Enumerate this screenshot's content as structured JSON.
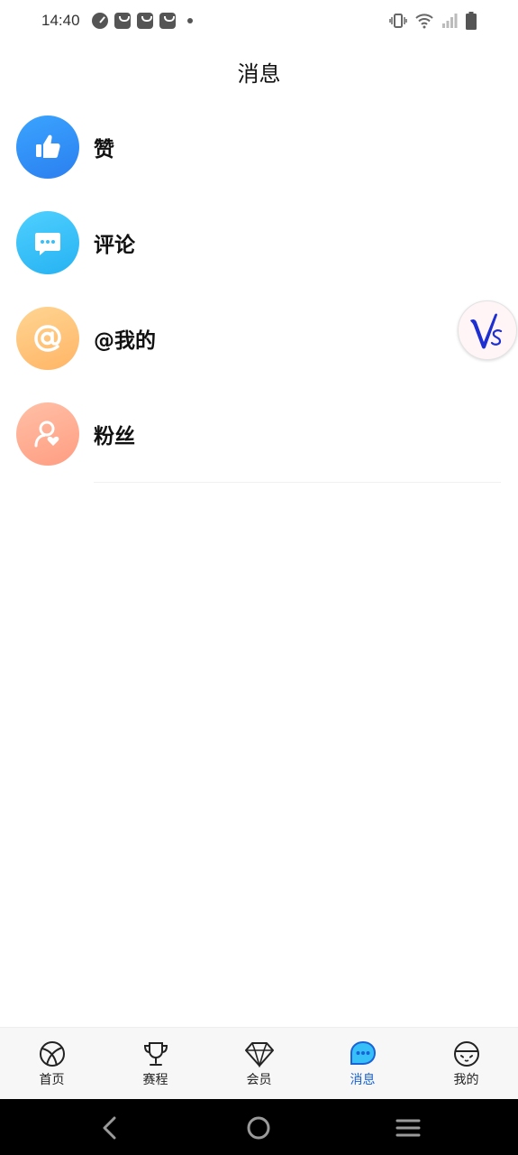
{
  "status_bar": {
    "time": "14:40",
    "icons": [
      "speedometer-icon",
      "bag-icon",
      "bag-icon",
      "bag-icon",
      "dot-icon",
      "vibrate-icon",
      "wifi-icon",
      "signal-icon",
      "battery-icon"
    ]
  },
  "header": {
    "title": "消息"
  },
  "messages": [
    {
      "label": "赞",
      "icon": "thumbs-up-icon",
      "color": "#2f8df5"
    },
    {
      "label": "评论",
      "icon": "chat-bubble-icon",
      "color": "#36c0f7"
    },
    {
      "label": "@我的",
      "icon": "at-sign-icon",
      "color": "#ffc477"
    },
    {
      "label": "粉丝",
      "icon": "fan-user-icon",
      "color": "#ffac92"
    }
  ],
  "floating_badge": {
    "icon": "vs-logo-icon"
  },
  "tabbar": {
    "tabs": [
      {
        "label": "首页",
        "icon": "basketball-icon"
      },
      {
        "label": "赛程",
        "icon": "trophy-icon"
      },
      {
        "label": "会员",
        "icon": "diamond-icon"
      },
      {
        "label": "消息",
        "icon": "message-bubble-icon"
      },
      {
        "label": "我的",
        "icon": "face-icon"
      }
    ],
    "active_index": 3,
    "active_color": "#1a62d8"
  },
  "navbar": {
    "buttons": [
      "back-icon",
      "home-icon",
      "menu-icon"
    ]
  }
}
